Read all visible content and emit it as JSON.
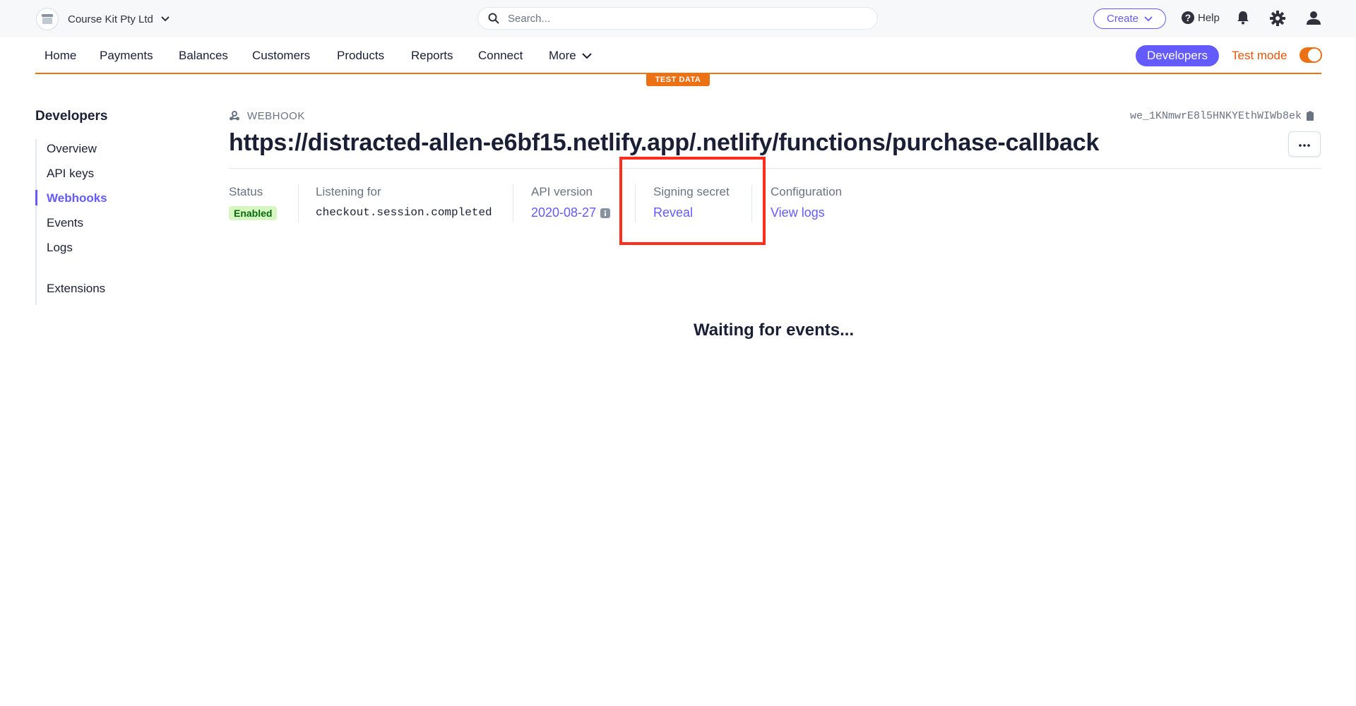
{
  "topbar": {
    "account_name": "Course Kit Pty Ltd",
    "search_placeholder": "Search...",
    "create_label": "Create",
    "help_label": "Help"
  },
  "nav": {
    "items": [
      "Home",
      "Payments",
      "Balances",
      "Customers",
      "Products",
      "Reports",
      "Connect",
      "More"
    ],
    "developers_label": "Developers",
    "test_mode_label": "Test mode",
    "test_mode_on": true,
    "test_data_banner": "TEST DATA"
  },
  "sidebar": {
    "title": "Developers",
    "items": [
      "Overview",
      "API keys",
      "Webhooks",
      "Events",
      "Logs",
      "Extensions"
    ],
    "active": "Webhooks"
  },
  "webhook": {
    "label": "WEBHOOK",
    "id": "we_1KNmwrE8l5HNKYEthWIWb8ek",
    "url": "https://distracted-allen-e6bf15.netlify.app/.netlify/functions/purchase-callback"
  },
  "details": {
    "status": {
      "label": "Status",
      "value": "Enabled"
    },
    "listening": {
      "label": "Listening for",
      "value": "checkout.session.completed"
    },
    "api_version": {
      "label": "API version",
      "value": "2020-08-27"
    },
    "signing_secret": {
      "label": "Signing secret",
      "value": "Reveal"
    },
    "configuration": {
      "label": "Configuration",
      "value": "View logs"
    }
  },
  "events": {
    "waiting_text": "Waiting for events..."
  },
  "colors": {
    "accent": "#635bff",
    "test_mode": "#ec7014",
    "highlight": "#ff2d1a",
    "badge_bg": "#d7f7c2",
    "badge_text": "#05690d"
  }
}
